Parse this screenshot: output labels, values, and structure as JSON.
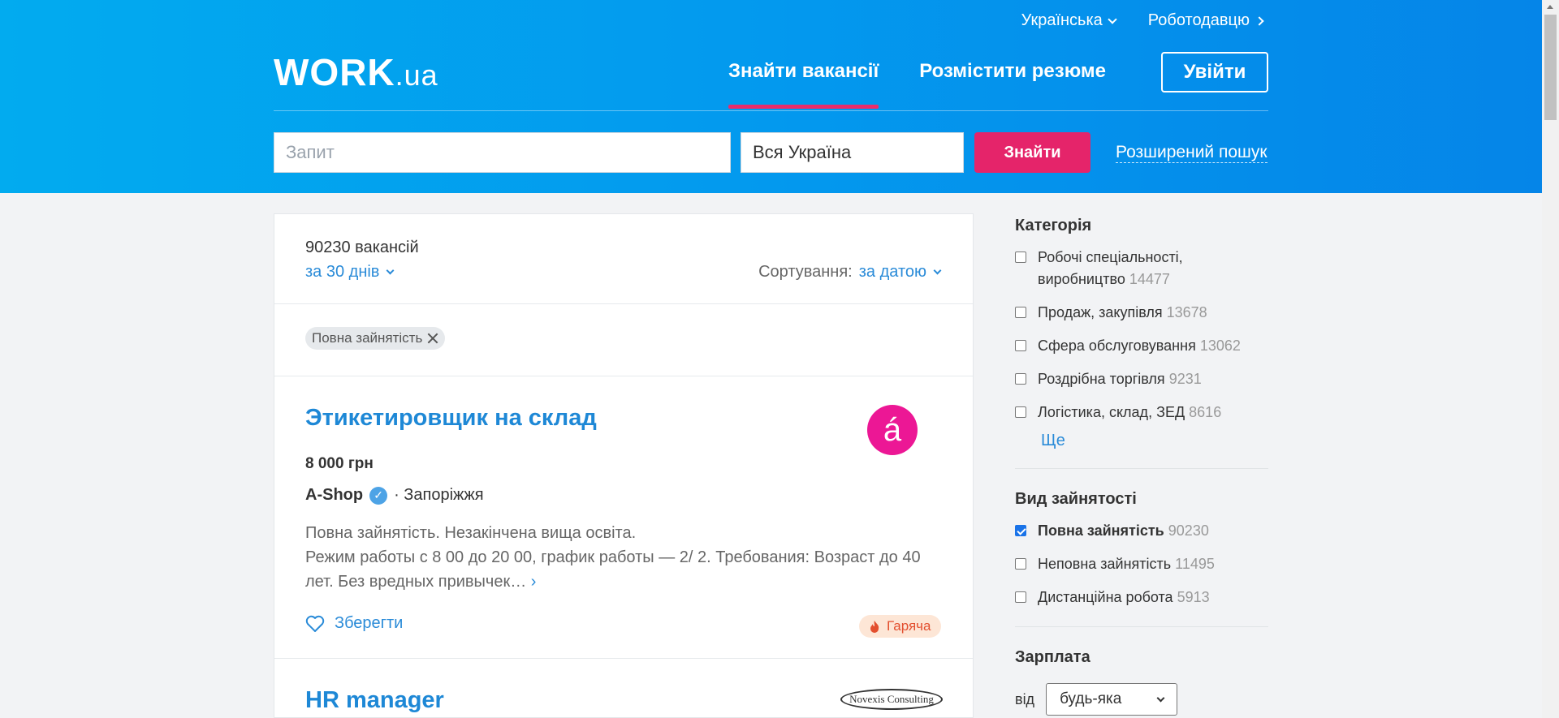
{
  "header": {
    "language": "Українська",
    "employer": "Роботодавцю",
    "logo_main": "WORK",
    "logo_suffix": ".ua",
    "nav": [
      "Знайти вакансії",
      "Розмістити резюме"
    ],
    "login": "Увійти",
    "search_placeholder": "Запит",
    "city_value": "Вся Україна",
    "find_button": "Знайти",
    "advanced_search": "Розширений пошук"
  },
  "results": {
    "count": "90230 вакансій",
    "period": "за 30 днів",
    "sort_label": "Сортування:",
    "sort_value": "за датою",
    "active_filter": "Повна зайнятість"
  },
  "jobs": [
    {
      "title": "Этикетировщик на склад",
      "logo_letter": "á",
      "salary": "8 000 грн",
      "company": "A-Shop",
      "city": "· Запоріжжя",
      "desc_line1": "Повна зайнятість. Незакінчена вища освіта.",
      "desc_line2": "Режим работы с 8 00 до 20 00, график работы — 2/ 2. Требования: Возраст до 40 лет. Без вредных привычек…",
      "save": "Зберегти",
      "badge": "Гаряча"
    },
    {
      "title": "HR manager",
      "logo_text": "Novexis Consulting"
    }
  ],
  "sidebar": {
    "category_title": "Категорія",
    "categories": [
      {
        "label": "Робочі спеціальності, виробництво",
        "count": "14477"
      },
      {
        "label": "Продаж, закупівля",
        "count": "13678"
      },
      {
        "label": "Сфера обслуговування",
        "count": "13062"
      },
      {
        "label": "Роздрібна торгівля",
        "count": "9231"
      },
      {
        "label": "Логістика, склад, ЗЕД",
        "count": "8616"
      }
    ],
    "more": "Ще",
    "employment_title": "Вид зайнятості",
    "employment": [
      {
        "label": "Повна зайнятість",
        "count": "90230",
        "checked": true
      },
      {
        "label": "Неповна зайнятість",
        "count": "11495",
        "checked": false
      },
      {
        "label": "Дистанційна робота",
        "count": "5913",
        "checked": false
      }
    ],
    "salary_title": "Зарплата",
    "salary_from": "від",
    "salary_select": "будь-яка"
  },
  "colors": {
    "header_gradient_start": "#02abef",
    "header_gradient_end": "#0585e8",
    "accent_pink": "#e5246a",
    "link_blue": "#2a8bd8"
  }
}
